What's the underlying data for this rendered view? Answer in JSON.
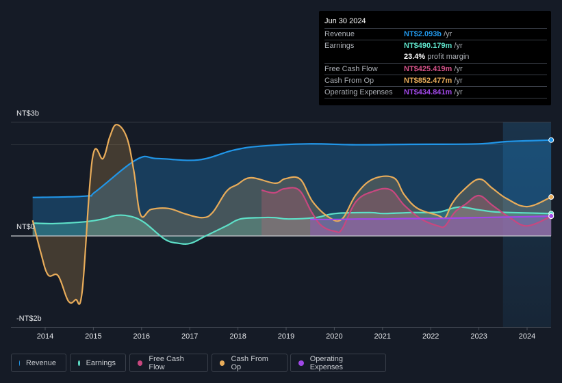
{
  "tooltip": {
    "date": "Jun 30 2024",
    "rows": [
      {
        "label": "Revenue",
        "value": "NT$2.093b",
        "unit": " /yr",
        "color": "#2196e8"
      },
      {
        "label": "Earnings",
        "value": "NT$490.179m",
        "unit": " /yr",
        "color": "#5ee0c8"
      },
      {
        "label": "",
        "value": "23.4%",
        "unit": " profit margin",
        "color": "#ffffff"
      },
      {
        "label": "Free Cash Flow",
        "value": "NT$425.419m",
        "unit": " /yr",
        "color": "#d6538a"
      },
      {
        "label": "Cash From Op",
        "value": "NT$852.477m",
        "unit": " /yr",
        "color": "#e8ac5a"
      },
      {
        "label": "Operating Expenses",
        "value": "NT$434.841m",
        "unit": " /yr",
        "color": "#a048e8"
      }
    ]
  },
  "legend": [
    {
      "label": "Revenue",
      "color": "#2196e8"
    },
    {
      "label": "Earnings",
      "color": "#5ee0c8"
    },
    {
      "label": "Free Cash Flow",
      "color": "#c9477f"
    },
    {
      "label": "Cash From Op",
      "color": "#e8ac5a"
    },
    {
      "label": "Operating Expenses",
      "color": "#a048e8"
    }
  ],
  "chart_data": {
    "type": "area",
    "title": "",
    "xlabel": "",
    "ylabel": "",
    "y_tick_labels": [
      "NT$3b",
      "NT$0",
      "-NT$2b"
    ],
    "x_tick_labels": [
      "2014",
      "2015",
      "2016",
      "2017",
      "2018",
      "2019",
      "2020",
      "2021",
      "2022",
      "2023",
      "2024"
    ],
    "xlim": [
      2013.7,
      2024.55
    ],
    "ylim": [
      -2.0,
      2.5
    ],
    "units": "NT$ billions",
    "grid": true,
    "highlight_from": 2023.5,
    "legend_position": "bottom",
    "series": [
      {
        "name": "Revenue",
        "color": "#2196e8",
        "x": [
          2013.74,
          2014.84,
          2015.05,
          2015.9,
          2016.33,
          2017.18,
          2017.9,
          2018.46,
          2019.45,
          2020.45,
          2021.59,
          2023.0,
          2023.57,
          2024.5
        ],
        "values": [
          0.84,
          0.87,
          0.97,
          1.67,
          1.69,
          1.66,
          1.87,
          1.96,
          2.01,
          1.99,
          2.0,
          2.01,
          2.06,
          2.093
        ]
      },
      {
        "name": "Earnings",
        "color": "#5ee0c8",
        "x": [
          2013.74,
          2014.2,
          2014.84,
          2015.2,
          2015.48,
          2015.76,
          2016.05,
          2016.48,
          2016.76,
          2017.02,
          2017.33,
          2017.76,
          2018.05,
          2018.48,
          2018.76,
          2019.05,
          2019.6,
          2020.02,
          2020.73,
          2021.02,
          2021.59,
          2022.15,
          2022.58,
          2023.0,
          2023.43,
          2024.5
        ],
        "values": [
          0.28,
          0.27,
          0.31,
          0.37,
          0.45,
          0.43,
          0.3,
          -0.07,
          -0.16,
          -0.16,
          0.0,
          0.22,
          0.37,
          0.4,
          0.4,
          0.37,
          0.4,
          0.49,
          0.51,
          0.49,
          0.51,
          0.52,
          0.63,
          0.57,
          0.52,
          0.49
        ]
      },
      {
        "name": "Free Cash Flow",
        "color": "#c9477f",
        "x": [
          2018.49,
          2018.75,
          2018.96,
          2019.27,
          2019.53,
          2019.74,
          2020.02,
          2020.16,
          2020.45,
          2020.8,
          2021.16,
          2021.45,
          2021.8,
          2022.15,
          2022.3,
          2022.5,
          2022.73,
          2023.0,
          2023.28,
          2023.64,
          2024.0,
          2024.5
        ],
        "values": [
          1.0,
          0.94,
          1.03,
          1.0,
          0.52,
          0.22,
          0.1,
          0.15,
          0.75,
          0.97,
          1.01,
          0.67,
          0.37,
          0.22,
          0.22,
          0.52,
          0.7,
          0.88,
          0.67,
          0.4,
          0.22,
          0.43
        ]
      },
      {
        "name": "Cash From Op",
        "color": "#e8ac5a",
        "x": [
          2013.74,
          2013.91,
          2014.06,
          2014.27,
          2014.48,
          2014.63,
          2014.77,
          2014.98,
          2015.2,
          2015.34,
          2015.48,
          2015.69,
          2015.84,
          2015.98,
          2016.2,
          2016.56,
          2016.91,
          2017.27,
          2017.48,
          2017.76,
          2017.98,
          2018.27,
          2018.77,
          2018.98,
          2019.29,
          2019.55,
          2019.9,
          2020.16,
          2020.45,
          2020.8,
          2021.23,
          2021.45,
          2021.73,
          2022.15,
          2022.3,
          2022.44,
          2022.65,
          2023.0,
          2023.28,
          2023.57,
          2024.0,
          2024.5
        ],
        "values": [
          0.34,
          -0.37,
          -0.85,
          -0.87,
          -1.42,
          -1.39,
          -1.19,
          1.69,
          1.69,
          2.16,
          2.43,
          2.16,
          1.42,
          0.46,
          0.58,
          0.6,
          0.48,
          0.4,
          0.52,
          0.97,
          1.12,
          1.27,
          1.15,
          1.25,
          1.24,
          0.75,
          0.4,
          0.37,
          0.9,
          1.24,
          1.27,
          0.9,
          0.6,
          0.45,
          0.4,
          0.7,
          0.97,
          1.24,
          1.04,
          0.82,
          0.64,
          0.85
        ]
      },
      {
        "name": "Operating Expenses",
        "color": "#a048e8",
        "x": [
          2019.5,
          2020.0,
          2020.5,
          2021.0,
          2021.5,
          2022.0,
          2022.5,
          2023.0,
          2023.5,
          2024.0,
          2024.5
        ],
        "values": [
          0.36,
          0.36,
          0.37,
          0.37,
          0.38,
          0.38,
          0.39,
          0.4,
          0.41,
          0.42,
          0.435
        ]
      }
    ]
  }
}
